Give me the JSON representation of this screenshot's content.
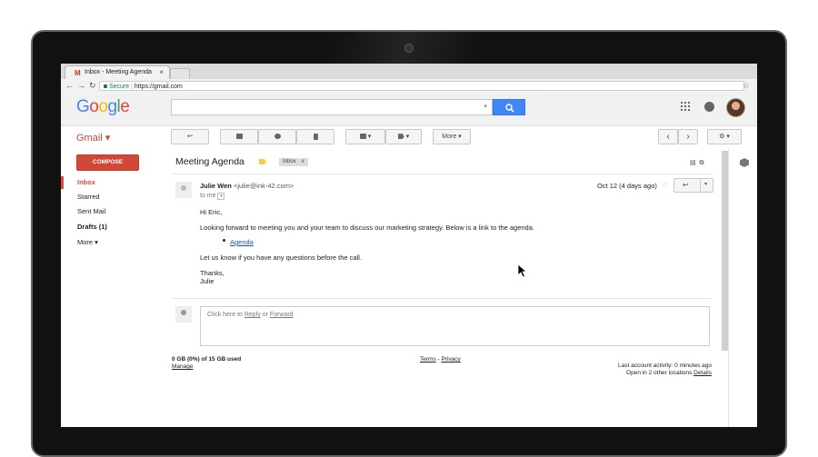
{
  "browser": {
    "tab_title": "Inbox - Meeting Agenda",
    "tab_close": "×",
    "secure_label": "Secure",
    "url": "https://gmail.com",
    "bookmark_star": "☆"
  },
  "header": {
    "logo_letters": [
      {
        "ch": "G",
        "color": "#4285f4"
      },
      {
        "ch": "o",
        "color": "#ea4335"
      },
      {
        "ch": "o",
        "color": "#fbbc05"
      },
      {
        "ch": "g",
        "color": "#4285f4"
      },
      {
        "ch": "l",
        "color": "#34a853"
      },
      {
        "ch": "e",
        "color": "#ea4335"
      }
    ],
    "search_value": "",
    "search_dropdown": "▾"
  },
  "toolbar": {
    "app_label": "Gmail ▾",
    "more_label": "More ▾",
    "nav_prev": "‹",
    "nav_next": "›",
    "settings_label": "⚙ ▾"
  },
  "sidebar": {
    "compose_label": "COMPOSE",
    "items": [
      {
        "label": "Inbox",
        "active": true
      },
      {
        "label": "Starred",
        "active": false
      },
      {
        "label": "Sent Mail",
        "active": false
      },
      {
        "label": "Drafts (1)",
        "active": false
      },
      {
        "label": "More ▾",
        "active": false
      }
    ]
  },
  "message": {
    "subject": "Meeting Agenda",
    "label": "Inbox",
    "label_close": "x",
    "sender_name": "Julie Wen",
    "sender_email": "<julie@ink-42.com>",
    "to_line": "to me",
    "date": "Oct 12 (4 days ago)",
    "greeting": "Hi Eric,",
    "paragraph1": "Looking forward to meeting you and your team to discuss our marketing strategy. Below is a link to the agenda.",
    "link_text": "Agenda",
    "paragraph2": "Let us know if you have any questions before the call.",
    "closing": "Thanks,",
    "signature": "Julie"
  },
  "reply": {
    "prefix": "Click here to ",
    "reply_link": "Reply",
    "or": " or ",
    "forward_link": "Forward"
  },
  "footer": {
    "storage": "0 GB (0%) of 15 GB used",
    "manage": "Manage",
    "terms": "Terms",
    "sep": " - ",
    "privacy": "Privacy",
    "activity": "Last account activity: 0 minutes ago",
    "locations": "Open in 2 other locations",
    "details": "Details"
  },
  "colors": {
    "gmail_red": "#d14836",
    "search_blue": "#4285f4",
    "link_blue": "#1155cc",
    "important_yellow": "#f7cb4d"
  }
}
